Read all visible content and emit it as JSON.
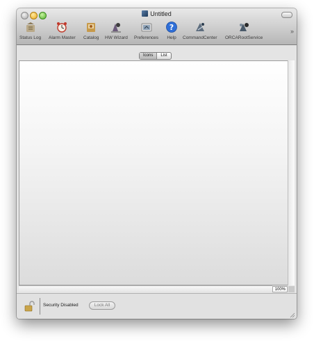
{
  "window": {
    "title": "Untitled"
  },
  "toolbar": {
    "items": [
      {
        "label": "Status Log",
        "icon": "status-log-icon"
      },
      {
        "label": "Alarm Master",
        "icon": "alarm-clock-icon"
      },
      {
        "label": "Catalog",
        "icon": "catalog-icon"
      },
      {
        "label": "HW Wizard",
        "icon": "hw-wizard-icon"
      },
      {
        "label": "Preferences",
        "icon": "preferences-icon"
      },
      {
        "label": "Help",
        "icon": "help-icon"
      },
      {
        "label": "CommandCenter",
        "icon": "command-center-icon"
      },
      {
        "label": "ORCARootService",
        "icon": "orca-root-service-icon"
      }
    ],
    "overflow": "»"
  },
  "view_toggle": {
    "options": [
      "Icons",
      "List"
    ],
    "selected": "Icons"
  },
  "zoom": {
    "value": "100%"
  },
  "footer": {
    "security_label": "Security Disabled",
    "lock_all_label": "Lock All"
  },
  "colors": {
    "help_blue": "#2f6fd8",
    "content_bg": "#f4f4f4"
  }
}
